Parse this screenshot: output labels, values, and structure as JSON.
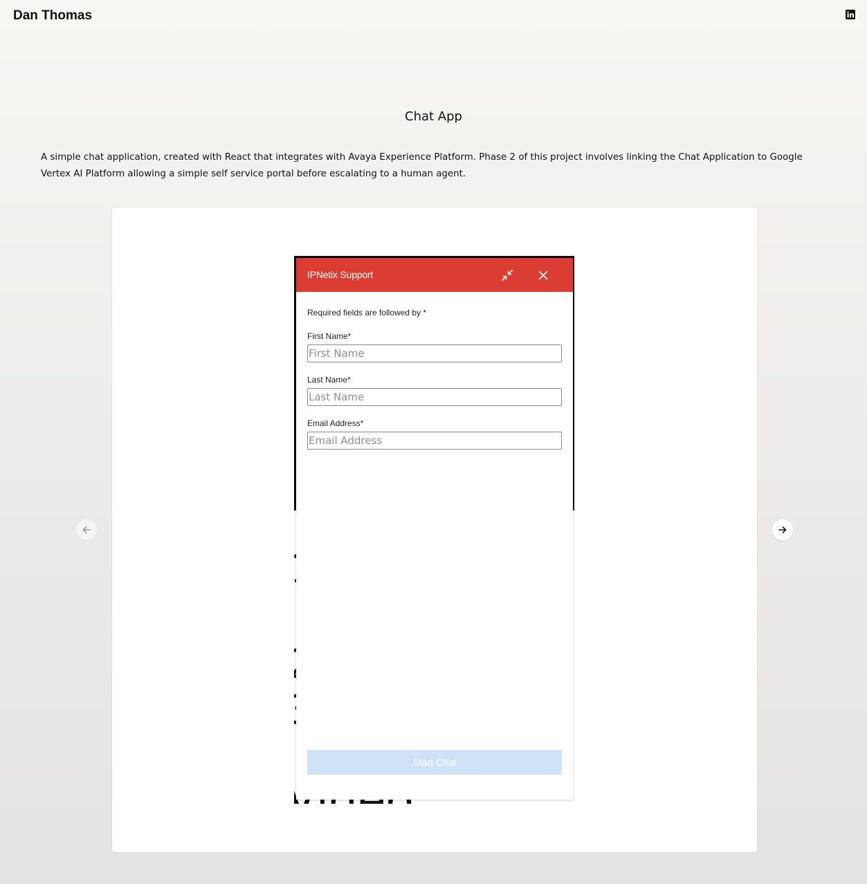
{
  "header": {
    "site_title": "Dan Thomas",
    "social_icon": "linkedin-icon"
  },
  "project": {
    "title": "Chat App",
    "description": "A simple chat application, created with React that integrates with Avaya Experience Platform. Phase 2 of this project involves linking the Chat Application to Google Vertex AI Platform allowing a simple self service portal before escalating to a human agent."
  },
  "gallery": {
    "prev_icon": "arrow-left-icon",
    "next_icon": "arrow-right-icon",
    "background_text": [
      "1",
      "2",
      "3",
      "Video"
    ]
  },
  "chat_widget": {
    "title": "IPNetix Support",
    "minimize_icon": "minimize-icon",
    "close_icon": "close-icon",
    "required_note": "Required fields are followed by *",
    "fields": [
      {
        "label": "First Name*",
        "placeholder": "First Name",
        "value": ""
      },
      {
        "label": "Last Name*",
        "placeholder": "Last Name",
        "value": ""
      },
      {
        "label": "Email Address*",
        "placeholder": "Email Address",
        "value": ""
      }
    ],
    "start_button": "Start Chat",
    "colors": {
      "header": "#dc3d33",
      "button_disabled": "#cfe2f8"
    }
  }
}
